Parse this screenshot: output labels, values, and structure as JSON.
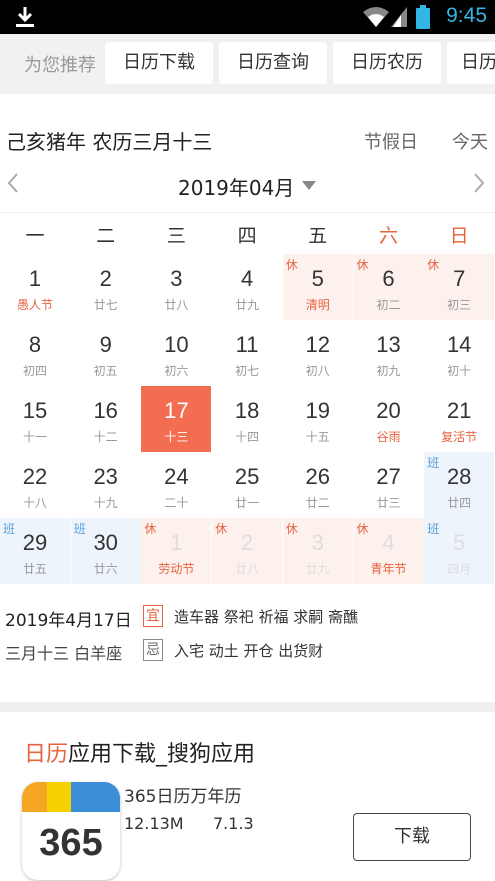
{
  "status_bar": {
    "time": "9:45"
  },
  "recommend": {
    "label": "为您推荐",
    "chips": [
      "日历下载",
      "日历查询",
      "日历农历",
      "日历"
    ]
  },
  "info": {
    "lunar_text": "己亥猪年 农历三月十三",
    "holiday_label": "节假日",
    "today_label": "今天"
  },
  "month": {
    "label": "2019年04月"
  },
  "weekdays": [
    "一",
    "二",
    "三",
    "四",
    "五",
    "六",
    "日"
  ],
  "weekday_colors": {
    "normal": "#333333",
    "weekend": "#e8623e"
  },
  "calendar": {
    "weeks": [
      [
        {
          "day": "1",
          "sub": "愚人节",
          "sub_red": true
        },
        {
          "day": "2",
          "sub": "廿七"
        },
        {
          "day": "3",
          "sub": "廿八"
        },
        {
          "day": "4",
          "sub": "廿九"
        },
        {
          "day": "5",
          "sub": "清明",
          "sub_red": true,
          "tag": "休",
          "kind": "rest"
        },
        {
          "day": "6",
          "sub": "初二",
          "tag": "休",
          "kind": "rest"
        },
        {
          "day": "7",
          "sub": "初三",
          "tag": "休",
          "kind": "rest"
        }
      ],
      [
        {
          "day": "8",
          "sub": "初四"
        },
        {
          "day": "9",
          "sub": "初五"
        },
        {
          "day": "10",
          "sub": "初六"
        },
        {
          "day": "11",
          "sub": "初七"
        },
        {
          "day": "12",
          "sub": "初八"
        },
        {
          "day": "13",
          "sub": "初九"
        },
        {
          "day": "14",
          "sub": "初十"
        }
      ],
      [
        {
          "day": "15",
          "sub": "十一"
        },
        {
          "day": "16",
          "sub": "十二"
        },
        {
          "day": "17",
          "sub": "十三",
          "kind": "sel"
        },
        {
          "day": "18",
          "sub": "十四"
        },
        {
          "day": "19",
          "sub": "十五"
        },
        {
          "day": "20",
          "sub": "谷雨",
          "sub_red": true
        },
        {
          "day": "21",
          "sub": "复活节",
          "sub_red": true
        }
      ],
      [
        {
          "day": "22",
          "sub": "十八"
        },
        {
          "day": "23",
          "sub": "十九"
        },
        {
          "day": "24",
          "sub": "二十"
        },
        {
          "day": "25",
          "sub": "廿一"
        },
        {
          "day": "26",
          "sub": "廿二"
        },
        {
          "day": "27",
          "sub": "廿三"
        },
        {
          "day": "28",
          "sub": "廿四",
          "tag": "班",
          "kind": "work"
        }
      ],
      [
        {
          "day": "29",
          "sub": "廿五",
          "tag": "班",
          "kind": "work"
        },
        {
          "day": "30",
          "sub": "廿六",
          "tag": "班",
          "kind": "work"
        },
        {
          "day": "1",
          "sub": "劳动节",
          "sub_red": true,
          "tag": "休",
          "kind": "rest",
          "dim": true
        },
        {
          "day": "2",
          "sub": "廿八",
          "tag": "休",
          "kind": "rest",
          "dim": true
        },
        {
          "day": "3",
          "sub": "廿九",
          "tag": "休",
          "kind": "rest",
          "dim": true
        },
        {
          "day": "4",
          "sub": "青年节",
          "sub_red": true,
          "tag": "休",
          "kind": "rest",
          "dim": true
        },
        {
          "day": "5",
          "sub": "四月",
          "tag": "班",
          "kind": "work",
          "dim": true
        }
      ]
    ]
  },
  "almanac": {
    "date": "2019年4月17日",
    "lunar": "三月十三 白羊座",
    "yi_label": "宜",
    "yi_text": "造车器 祭祀 祈福 求嗣 斋醮",
    "ji_label": "忌",
    "ji_text": "入宅 动土 开仓 出货财"
  },
  "ad": {
    "title_highlight": "日历",
    "title_rest": "应用下载_搜狗应用",
    "app_name": "365日历万年历",
    "app_size": "12.13M",
    "app_version": "7.1.3",
    "download_label": "下载",
    "icon_text": "365",
    "icon_colors": [
      "#f5a623",
      "#f8d200",
      "#3a8fd6",
      "#3a8fd6"
    ]
  },
  "colors": {
    "accent": "#e8623e",
    "selected": "#f36d51",
    "work": "#5aa0d8",
    "status_time": "#33b5e5"
  }
}
